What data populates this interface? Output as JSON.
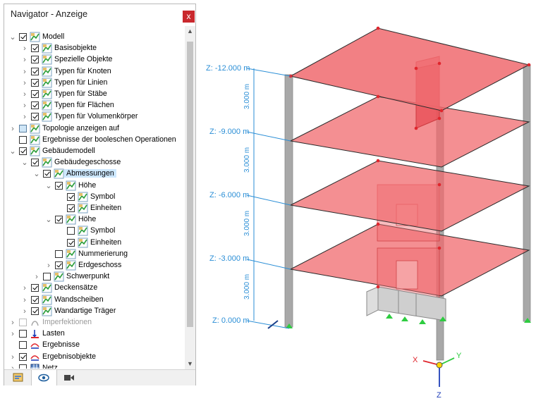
{
  "navigator": {
    "title": "Navigator - Anzeige",
    "close": "x",
    "items": [
      {
        "label": "Modell"
      },
      {
        "label": "Basisobjekte"
      },
      {
        "label": "Spezielle Objekte"
      },
      {
        "label": "Typen für Knoten"
      },
      {
        "label": "Typen für Linien"
      },
      {
        "label": "Typen für Stäbe"
      },
      {
        "label": "Typen für Flächen"
      },
      {
        "label": "Typen für Volumenkörper"
      },
      {
        "label": "Topologie anzeigen auf"
      },
      {
        "label": "Ergebnisse der booleschen Operationen"
      },
      {
        "label": "Gebäudemodell"
      },
      {
        "label": "Gebäudegeschosse"
      },
      {
        "label": "Abmessungen"
      },
      {
        "label": "Höhe"
      },
      {
        "label": "Symbol"
      },
      {
        "label": "Einheiten"
      },
      {
        "label": "Höhe"
      },
      {
        "label": "Symbol"
      },
      {
        "label": "Einheiten"
      },
      {
        "label": "Nummerierung"
      },
      {
        "label": "Erdgeschoss"
      },
      {
        "label": "Schwerpunkt"
      },
      {
        "label": "Deckensätze"
      },
      {
        "label": "Wandscheiben"
      },
      {
        "label": "Wandartige Träger"
      },
      {
        "label": "Imperfektionen"
      },
      {
        "label": "Lasten"
      },
      {
        "label": "Ergebnisse"
      },
      {
        "label": "Ergebnisobjekte"
      },
      {
        "label": "Netz"
      }
    ],
    "tabs": [
      "data-tab",
      "view-tab",
      "video-tab"
    ]
  },
  "scene": {
    "levels": [
      {
        "label": "Z: -12.000 m"
      },
      {
        "label": "Z: -9.000 m"
      },
      {
        "label": "Z: -6.000 m"
      },
      {
        "label": "Z: -3.000 m"
      },
      {
        "label": "Z: 0.000 m"
      }
    ],
    "dimensions": [
      "3.000 m",
      "3.000 m",
      "3.000 m",
      "3.000 m"
    ],
    "axes": {
      "x": "X",
      "y": "Y",
      "z": "Z"
    },
    "colors": {
      "slab": "#f06a6e",
      "dimension": "#2a8ed6",
      "support": "#2ecc40",
      "column": "#a8a8a8"
    }
  }
}
